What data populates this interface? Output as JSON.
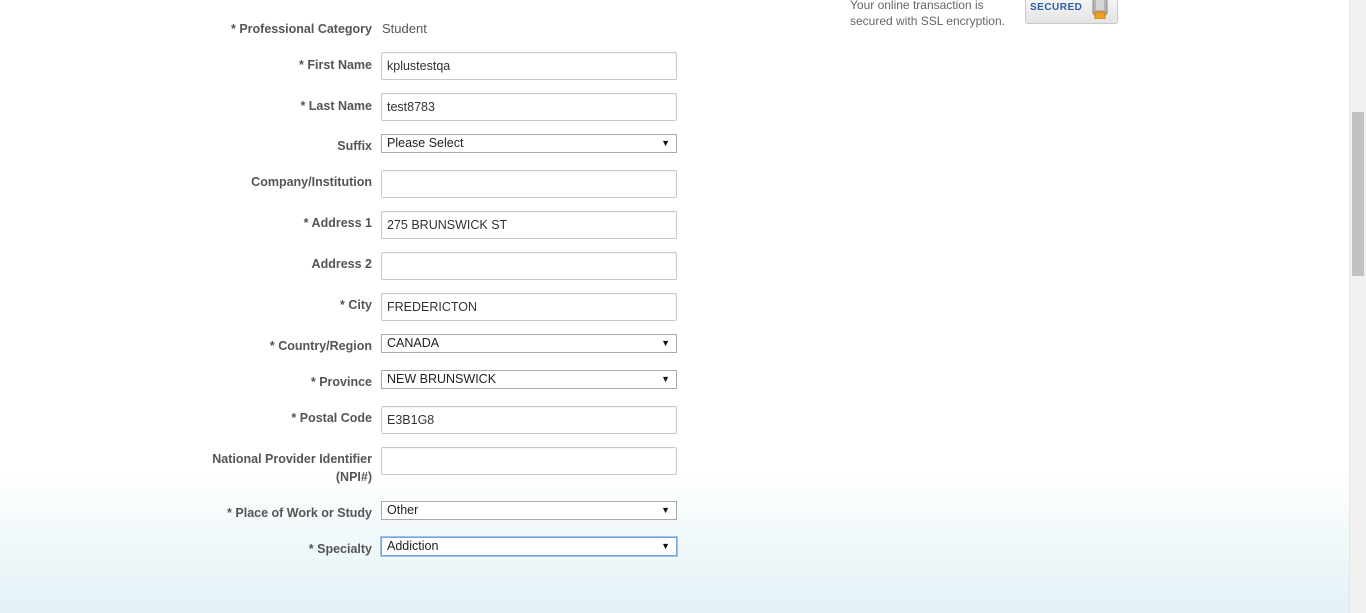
{
  "secure": {
    "text": "Your online transaction is secured with SSL encryption.",
    "badge_text": "SECURED"
  },
  "form": {
    "professional_category": {
      "label": "* Professional Category",
      "value": "Student"
    },
    "first_name": {
      "label": "* First Name",
      "value": "kplustestqa"
    },
    "last_name": {
      "label": "* Last Name",
      "value": "test8783"
    },
    "suffix": {
      "label": "Suffix",
      "value": "Please Select"
    },
    "company": {
      "label": "Company/Institution",
      "value": ""
    },
    "address1": {
      "label": "* Address 1",
      "value": "275 BRUNSWICK ST"
    },
    "address2": {
      "label": "Address 2",
      "value": ""
    },
    "city": {
      "label": "* City",
      "value": "FREDERICTON"
    },
    "country": {
      "label": "* Country/Region",
      "value": "CANADA"
    },
    "province": {
      "label": "* Province",
      "value": "NEW BRUNSWICK"
    },
    "postal_code": {
      "label": "* Postal Code",
      "value": "E3B1G8"
    },
    "npi": {
      "label_line1": "National Provider Identifier",
      "label_line2": "(NPI#)",
      "value": ""
    },
    "place_of_work": {
      "label": "* Place of Work or Study",
      "value": "Other"
    },
    "specialty": {
      "label": "* Specialty",
      "value": "Addiction"
    }
  },
  "icons": {
    "dropdown_arrow": "▼",
    "lock": "lock-icon"
  }
}
